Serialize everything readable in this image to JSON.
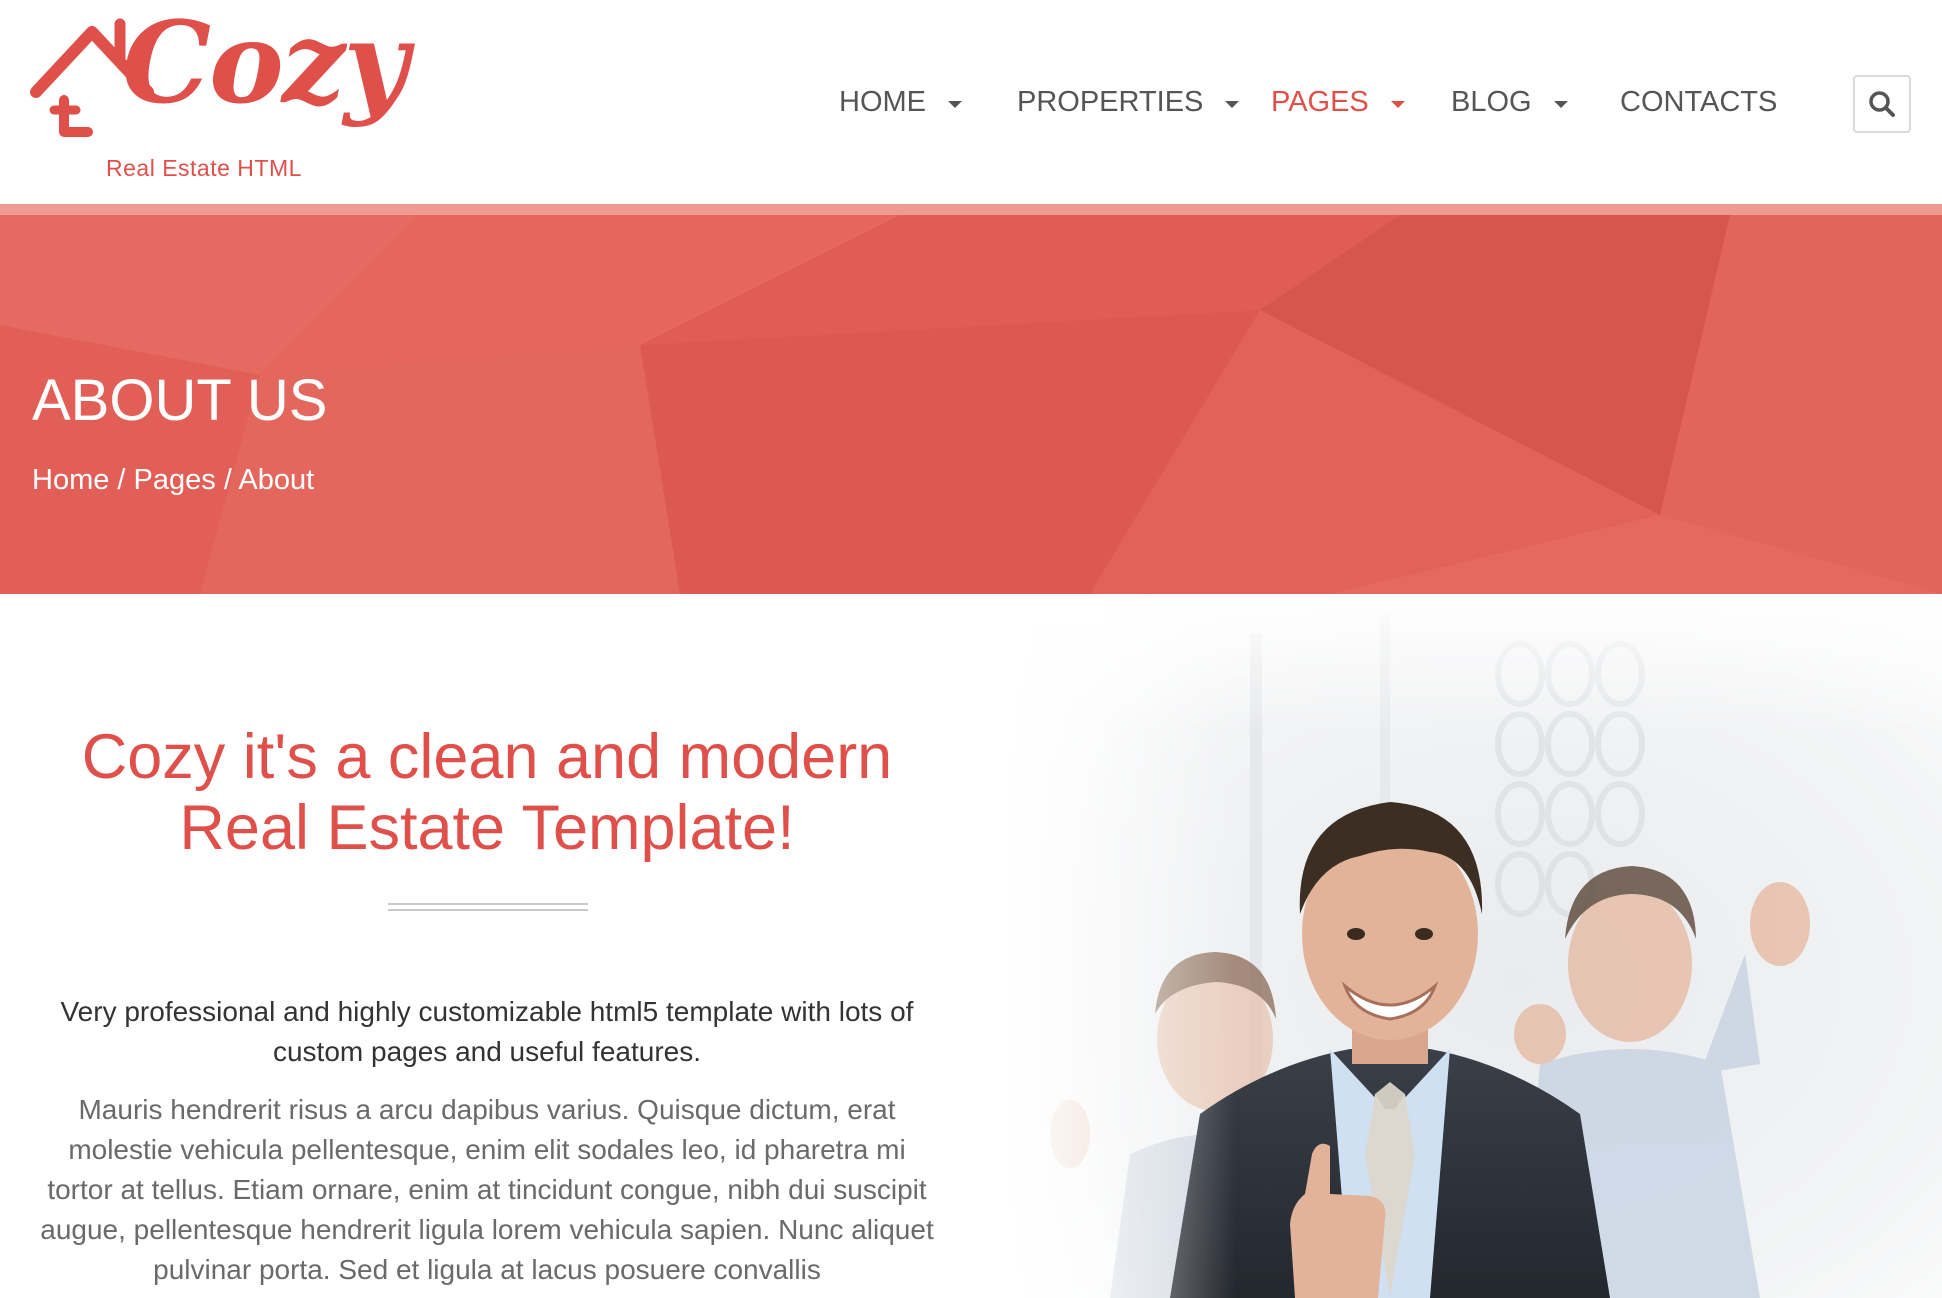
{
  "brand": {
    "logo_word": "Cozy",
    "logo_sub": "Real Estate HTML",
    "accent": "#e0504b",
    "banner_color": "#e5655c"
  },
  "nav": {
    "items": [
      {
        "label": "HOME",
        "has_dropdown": true,
        "active": false
      },
      {
        "label": "PROPERTIES",
        "has_dropdown": true,
        "active": false
      },
      {
        "label": "PAGES",
        "has_dropdown": true,
        "active": true
      },
      {
        "label": "BLOG",
        "has_dropdown": true,
        "active": false
      },
      {
        "label": "CONTACTS",
        "has_dropdown": false,
        "active": false
      }
    ],
    "search_icon": "search-icon"
  },
  "banner": {
    "title": "ABOUT US",
    "breadcrumb": {
      "home": "Home",
      "pages": "Pages",
      "current": "About",
      "separator": "/"
    }
  },
  "about": {
    "headline_line1": "Cozy it's a clean and modern",
    "headline_line2": "Real Estate Template!",
    "lead": "Very professional and highly customizable html5 template with lots of custom pages and useful features.",
    "body": "Mauris hendrerit risus a arcu dapibus varius. Quisque dictum, erat molestie vehicula pellentesque, enim elit sodales leo, id pharetra mi tortor at tellus. Etiam ornare, enim at tincidunt congue, nibh dui suscipit augue, pellentesque hendrerit ligula lorem vehicula sapien. Nunc aliquet pulvinar porta. Sed et ligula at lacus posuere convallis"
  }
}
